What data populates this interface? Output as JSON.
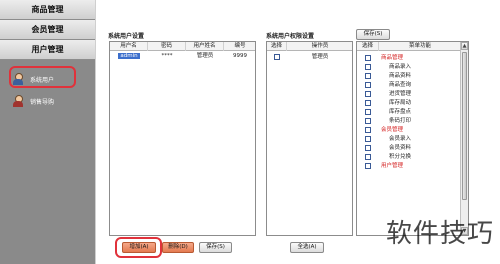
{
  "sidebar": {
    "headers": [
      "商品管理",
      "会员管理",
      "用户管理"
    ],
    "items": [
      {
        "label": "系统用户",
        "icon": "user-icon"
      },
      {
        "label": "销售导购",
        "icon": "sales-guide-icon"
      }
    ]
  },
  "users": {
    "title": "系统用户设置",
    "columns": [
      "用户名",
      "密码",
      "用户姓名",
      "编号"
    ],
    "rows": [
      {
        "username": "admin",
        "password": "****",
        "name": "管理员",
        "number": "9999"
      }
    ],
    "buttons": {
      "add": "增加(A)",
      "delete": "删除(D)",
      "save": "保存(S)"
    }
  },
  "roles": {
    "title": "系统用户权限设置",
    "columns": [
      "选择",
      "操作员"
    ],
    "items": [
      {
        "label": "管理员",
        "checked": false
      }
    ],
    "select_all": "全选(A)"
  },
  "permissions": {
    "save": "保存(S)",
    "columns": [
      "选择",
      "菜单功能"
    ],
    "items": [
      {
        "label": "商品管理",
        "group": true
      },
      {
        "label": "商品录入",
        "group": false
      },
      {
        "label": "商品资料",
        "group": false
      },
      {
        "label": "商品查询",
        "group": false
      },
      {
        "label": "进货管理",
        "group": false
      },
      {
        "label": "库存局动",
        "group": false
      },
      {
        "label": "库存盘点",
        "group": false
      },
      {
        "label": "条码打印",
        "group": false
      },
      {
        "label": "会员管理",
        "group": true
      },
      {
        "label": "会员录入",
        "group": false
      },
      {
        "label": "会员资料",
        "group": false
      },
      {
        "label": "积分兑换",
        "group": false
      },
      {
        "label": "用户管理",
        "group": true
      }
    ]
  },
  "watermark": "软件技巧",
  "colors": {
    "highlight": "#e0323b",
    "group_text": "#d42020",
    "selection": "#3c6fcc"
  }
}
